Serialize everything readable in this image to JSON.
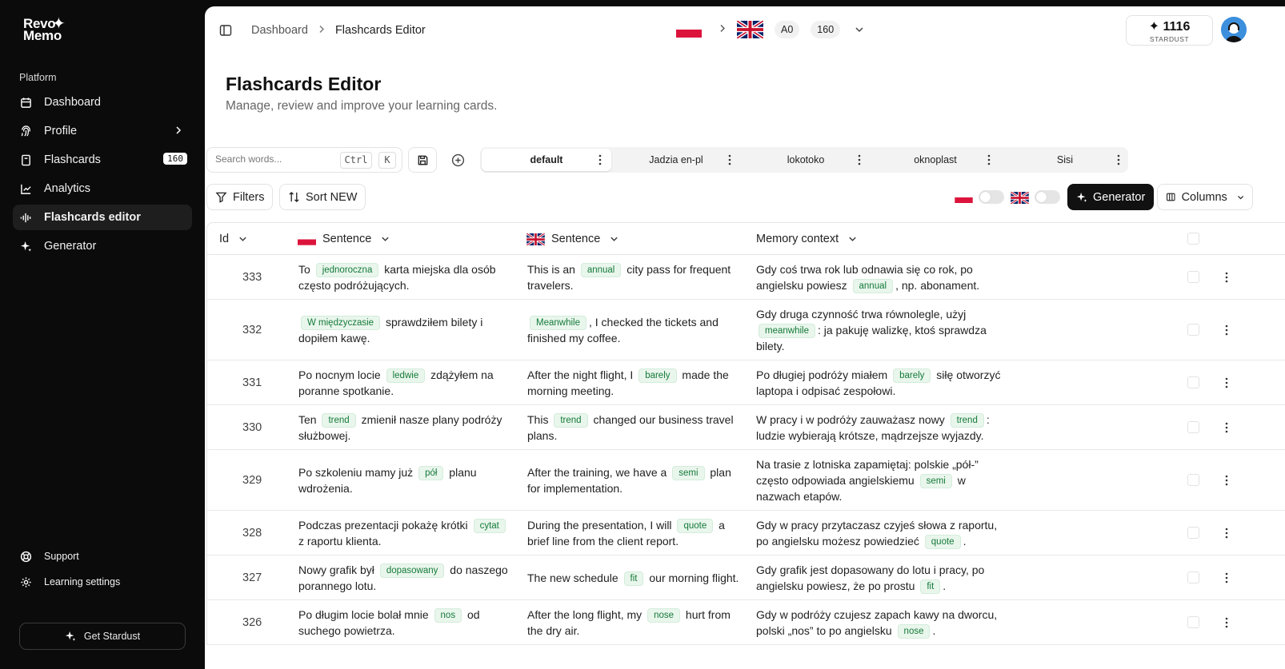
{
  "brand": {
    "line1": "Revo",
    "line2": "Memo"
  },
  "sidebar": {
    "section_label": "Platform",
    "items": [
      {
        "label": "Dashboard",
        "icon": "calendar-icon"
      },
      {
        "label": "Profile",
        "icon": "fingerprint-icon"
      },
      {
        "label": "Flashcards",
        "icon": "card-icon",
        "count": "160"
      },
      {
        "label": "Analytics",
        "icon": "chart-icon"
      },
      {
        "label": "Flashcards editor",
        "icon": "waveform-icon",
        "active": true
      },
      {
        "label": "Generator",
        "icon": "sparkle-icon"
      }
    ],
    "bottom": [
      {
        "label": "Support",
        "icon": "lifebuoy-icon"
      },
      {
        "label": "Learning settings",
        "icon": "gear-icon"
      }
    ],
    "stardust_button": "Get Stardust"
  },
  "topbar": {
    "breadcrumb": [
      "Dashboard",
      "Flashcards Editor"
    ],
    "level": "A0",
    "count": "160",
    "stardust": {
      "value": "1116",
      "label": "STARDUST"
    }
  },
  "page": {
    "title": "Flashcards Editor",
    "subtitle": "Manage, review and improve your learning cards."
  },
  "search": {
    "placeholder": "Search words...",
    "kbd1": "Ctrl",
    "kbd2": "K"
  },
  "decks": [
    "default",
    "Jadzia en-pl",
    "lokotoko",
    "oknoplast",
    "Sisi"
  ],
  "toolbar": {
    "filters": "Filters",
    "sort": "Sort NEW",
    "generator": "Generator",
    "columns": "Columns"
  },
  "table": {
    "headers": {
      "id": "Id",
      "pl": "Sentence",
      "en": "Sentence",
      "ctx": "Memory context"
    },
    "rows": [
      {
        "id": "333",
        "pl": [
          "To ",
          "jednoroczna",
          " karta miejska dla osób często podróżujących."
        ],
        "en": [
          "This is an ",
          "annual",
          " city pass for frequent travelers."
        ],
        "ctx": [
          "Gdy coś trwa rok lub odnawia się co rok, po angielsku powiesz ",
          "annual",
          ", np. abonament."
        ]
      },
      {
        "id": "332",
        "pl": [
          "",
          "W międzyczasie",
          " sprawdziłem bilety i dopiłem kawę."
        ],
        "en": [
          "",
          "Meanwhile",
          ", I checked the tickets and finished my coffee."
        ],
        "ctx": [
          "Gdy druga czynność trwa równolegle, użyj ",
          "meanwhile",
          ": ja pakuję walizkę, ktoś sprawdza bilety."
        ]
      },
      {
        "id": "331",
        "pl": [
          "Po nocnym locie ",
          "ledwie",
          " zdążyłem na poranne spotkanie."
        ],
        "en": [
          "After the night flight, I ",
          "barely",
          " made the morning meeting."
        ],
        "ctx": [
          "Po długiej podróży miałem ",
          "barely",
          " siłę otworzyć laptopa i odpisać zespołowi."
        ]
      },
      {
        "id": "330",
        "pl": [
          "Ten ",
          "trend",
          " zmienił nasze plany podróży służbowej."
        ],
        "en": [
          "This ",
          "trend",
          " changed our business travel plans."
        ],
        "ctx": [
          "W pracy i w podróży zauważasz nowy ",
          "trend",
          ": ludzie wybierają krótsze, mądrzejsze wyjazdy."
        ]
      },
      {
        "id": "329",
        "pl": [
          "Po szkoleniu mamy już ",
          "pół",
          " planu wdrożenia."
        ],
        "en": [
          "After the training, we have a ",
          "semi",
          " plan for implementation."
        ],
        "ctx": [
          "Na trasie z lotniska zapamiętaj: polskie „pół-” często odpowiada angielskiemu ",
          "semi",
          " w nazwach etapów."
        ]
      },
      {
        "id": "328",
        "pl": [
          "Podczas prezentacji pokażę krótki ",
          "cytat",
          " z raportu klienta."
        ],
        "en": [
          "During the presentation, I will ",
          "quote",
          " a brief line from the client report."
        ],
        "ctx": [
          "Gdy w pracy przytaczasz czyjeś słowa z raportu, po angielsku możesz powiedzieć ",
          "quote",
          "."
        ]
      },
      {
        "id": "327",
        "pl": [
          "Nowy grafik był ",
          "dopasowany",
          " do naszego porannego lotu."
        ],
        "en": [
          "The new schedule ",
          "fit",
          " our morning flight."
        ],
        "ctx": [
          "Gdy grafik jest dopasowany do lotu i pracy, po angielsku powiesz, że po prostu ",
          "fit",
          "."
        ]
      },
      {
        "id": "326",
        "pl": [
          "Po długim locie bolał mnie ",
          "nos",
          " od suchego powietrza."
        ],
        "en": [
          "After the long flight, my ",
          "nose",
          " hurt from the dry air."
        ],
        "ctx": [
          "Gdy w podróży czujesz zapach kawy na dworcu, polski „nos” to po angielsku ",
          "nose",
          "."
        ]
      }
    ]
  },
  "colors": {
    "sidebar_bg": "#0b0b0b",
    "highlight_bg": "#e9f6ec",
    "highlight_text": "#157a3a",
    "primary": "#111111"
  }
}
